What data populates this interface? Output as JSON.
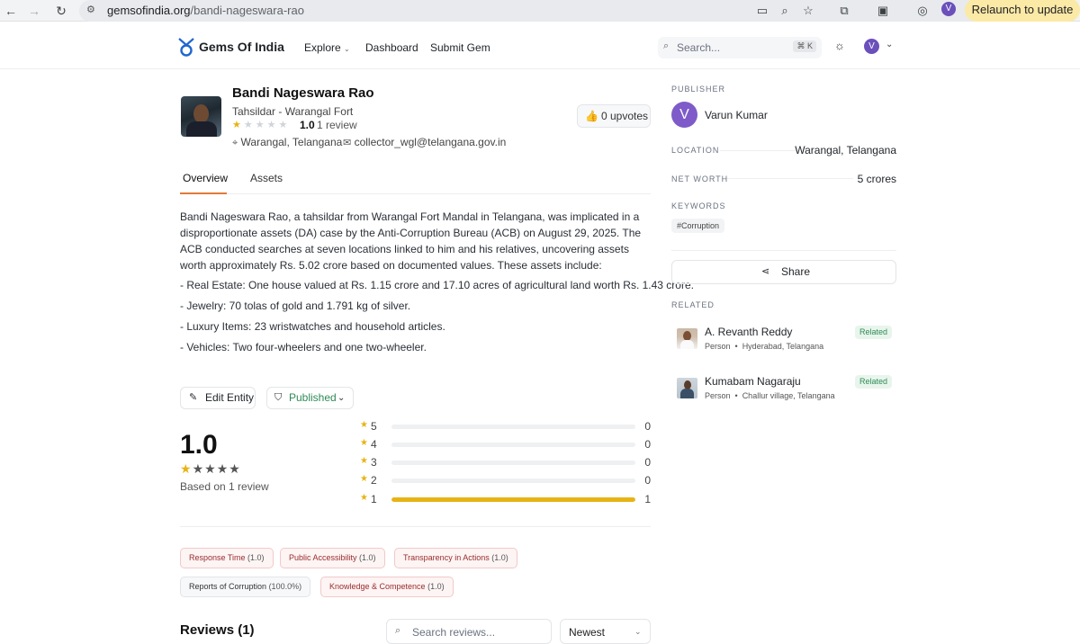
{
  "browser": {
    "url_host": "gemsofindia.org",
    "url_path": "/bandi-nageswara-rao",
    "relaunch_label": "Relaunch to update",
    "profile_initial": "V"
  },
  "site": {
    "brand": "Gems Of India",
    "nav": {
      "explore": "Explore",
      "dashboard": "Dashboard",
      "submit": "Submit Gem"
    },
    "search_placeholder": "Search...",
    "search_shortcut": "⌘ K",
    "user_initial": "V"
  },
  "entity": {
    "name": "Bandi Nageswara Rao",
    "role": "Tahsildar - Warangal Fort",
    "rating": "1.0",
    "rating_value": 1,
    "review_count": "1 review",
    "location": "Warangal, Telangana",
    "email": "collector_wgl@telangana.gov.in",
    "upvotes": "0 upvotes"
  },
  "tabs": {
    "overview": "Overview",
    "assets": "Assets"
  },
  "description": {
    "paragraph": "Bandi Nageswara Rao, a tahsildar from Warangal Fort Mandal in Telangana, was implicated in a disproportionate assets (DA) case by the Anti-Corruption Bureau (ACB) on August 29, 2025. The ACB conducted searches at seven locations linked to him and his relatives, uncovering assets worth approximately Rs. 5.02 crore based on documented values. These assets include:",
    "bullets": [
      "- Real Estate: One house valued at Rs. 1.15 crore and 17.10 acres of agricultural land worth Rs. 1.43 crore.",
      "- Jewelry: 70 tolas of gold and 1.791 kg of silver.",
      "- Luxury Items: 23 wristwatches and household articles.",
      "- Vehicles: Two four-wheelers and one two-wheeler."
    ]
  },
  "actions": {
    "edit": "Edit Entity",
    "status": "Published"
  },
  "rating_summary": {
    "average": "1.0",
    "based_on": "Based on 1 review",
    "distribution": [
      {
        "stars": "5",
        "count": "0",
        "fraction": 0
      },
      {
        "stars": "4",
        "count": "0",
        "fraction": 0
      },
      {
        "stars": "3",
        "count": "0",
        "fraction": 0
      },
      {
        "stars": "2",
        "count": "0",
        "fraction": 0
      },
      {
        "stars": "1",
        "count": "1",
        "fraction": 1
      }
    ]
  },
  "criteria": [
    {
      "label": "Response Time",
      "score": "(1.0)",
      "tone": "red"
    },
    {
      "label": "Public Accessibility",
      "score": "(1.0)",
      "tone": "red"
    },
    {
      "label": "Transparency in Actions",
      "score": "(1.0)",
      "tone": "red"
    },
    {
      "label": "Reports of Corruption",
      "score": "(100.0%)",
      "tone": "neutral"
    },
    {
      "label": "Knowledge & Competence",
      "score": "(1.0)",
      "tone": "red"
    }
  ],
  "reviews": {
    "title": "Reviews (1)",
    "search_placeholder": "Search reviews...",
    "sort": "Newest"
  },
  "sidebar": {
    "publisher_label": "PUBLISHER",
    "publisher_initial": "V",
    "publisher_name": "Varun Kumar",
    "location_label": "LOCATION",
    "location_value": "Warangal, Telangana",
    "networth_label": "NET WORTH",
    "networth_value": "5 crores",
    "keywords_label": "KEYWORDS",
    "keyword": "#Corruption",
    "share": "Share",
    "related_label": "RELATED",
    "related": [
      {
        "name": "A. Revanth Reddy",
        "type": "Person",
        "place": "Hyderabad, Telangana",
        "badge": "Related"
      },
      {
        "name": "Kumabam Nagaraju",
        "type": "Person",
        "place": "Challur village, Telangana",
        "badge": "Related"
      }
    ]
  },
  "colors": {
    "accent": "#e07a3b",
    "star": "#e7b416",
    "published": "#2e8b57",
    "publisher_avatar": "#7e5bc9"
  }
}
